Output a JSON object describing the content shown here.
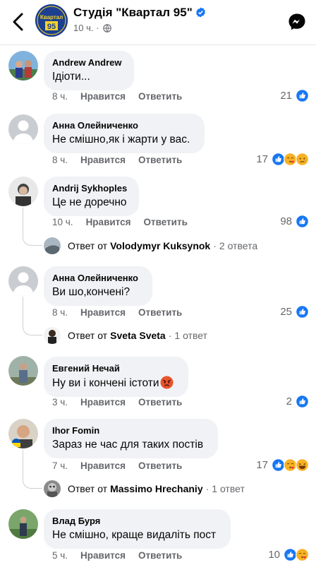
{
  "header": {
    "page_name": "Студія \"Квартал 95\"",
    "time": "10 ч.",
    "separator": "·",
    "logo_text_top": "Квартал",
    "logo_text_bottom": "95"
  },
  "labels": {
    "like": "Нравится",
    "reply": "Ответить",
    "reply_prefix": "Ответ от",
    "dot": "·"
  },
  "comments": [
    {
      "author": "Andrew Andrew",
      "text": "Ідіоти...",
      "time": "8 ч.",
      "reactions_count": "21",
      "reactions": [
        "like"
      ]
    },
    {
      "author": "Анна Олейниченко",
      "text": "Не смішно,як і жарти у вас.",
      "time": "8 ч.",
      "reactions_count": "17",
      "reactions": [
        "like",
        "kiss",
        "sad"
      ]
    },
    {
      "author": "Andrij Sykhoples",
      "text": "Це не доречно",
      "time": "10 ч.",
      "reactions_count": "98",
      "reactions": [
        "like"
      ],
      "reply": {
        "name": "Volodymyr Kuksynok",
        "count": "2 ответа"
      }
    },
    {
      "author": "Анна Олейниченко",
      "text": "Ви шо,кончені?",
      "time": "8 ч.",
      "reactions_count": "25",
      "reactions": [
        "like"
      ],
      "reply": {
        "name": "Sveta Sveta",
        "count": "1 ответ"
      }
    },
    {
      "author": "Евгений Нечай",
      "text": "Ну ви і кончені істоти",
      "inline_emoji": "angry-face",
      "time": "3 ч.",
      "reactions_count": "2",
      "reactions": [
        "like"
      ]
    },
    {
      "author": "Ihor Fomin",
      "text": "Зараз не час для таких постів",
      "time": "7 ч.",
      "reactions_count": "17",
      "reactions": [
        "like",
        "kiss",
        "haha"
      ],
      "reply": {
        "name": "Massimo Hrechaniy",
        "count": "1 ответ"
      }
    },
    {
      "author": "Влад Буря",
      "text": "Не смішно, краще видаліть пост",
      "time": "5 ч.",
      "reactions_count": "10",
      "reactions": [
        "like",
        "kiss"
      ]
    }
  ],
  "colors": {
    "bubble": "#f0f2f5",
    "meta": "#65676b",
    "like": "#1877f2",
    "thread": "#ccd0d5"
  }
}
